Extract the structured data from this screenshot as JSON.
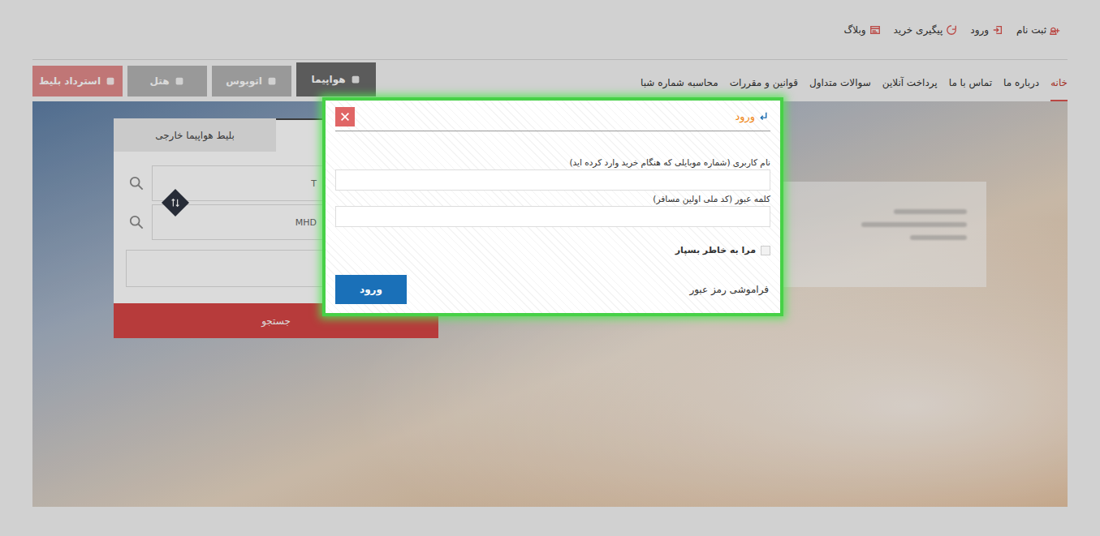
{
  "top_links": [
    {
      "label": "ثبت نام"
    },
    {
      "label": "ورود"
    },
    {
      "label": "پیگیری خرید"
    },
    {
      "label": "وبلاگ"
    }
  ],
  "main_nav": [
    {
      "label": "خانه",
      "selected": true
    },
    {
      "label": "درباره ما",
      "selected": false
    },
    {
      "label": "تماس با ما",
      "selected": false
    },
    {
      "label": "پرداخت آنلاین",
      "selected": false
    },
    {
      "label": "سوالات متداول",
      "selected": false
    },
    {
      "label": "قوانین و مقررات",
      "selected": false
    },
    {
      "label": "محاسبه شماره شبا",
      "selected": false
    }
  ],
  "service_tabs": [
    {
      "label": "هواپیما",
      "selected": true,
      "color": "#6b6b6b"
    },
    {
      "label": "اتوبوس",
      "selected": false,
      "color": "#b3b3b3"
    },
    {
      "label": "هتل",
      "selected": false,
      "color": "#b3b3b3"
    },
    {
      "label": "استرداد بلیط",
      "selected": false,
      "color": "#e08a8a"
    }
  ],
  "search_panel": {
    "tab": "بلیط هواپیما خارجی",
    "origin": "T",
    "destination": "MHD",
    "button": "جستجو"
  },
  "login_modal": {
    "title": "ورود",
    "fields": [
      {
        "label": "نام کاربری (شماره موبایلی که هنگام خرید وارد کرده اید)",
        "value": ""
      },
      {
        "label": "کلمه عبور (کد ملی اولین مسافر)",
        "value": ""
      }
    ],
    "remember": {
      "label": "مرا به خاطر بسپار",
      "checked": false
    },
    "forgot": "فراموشی رمز عبور",
    "submit": "ورود"
  }
}
